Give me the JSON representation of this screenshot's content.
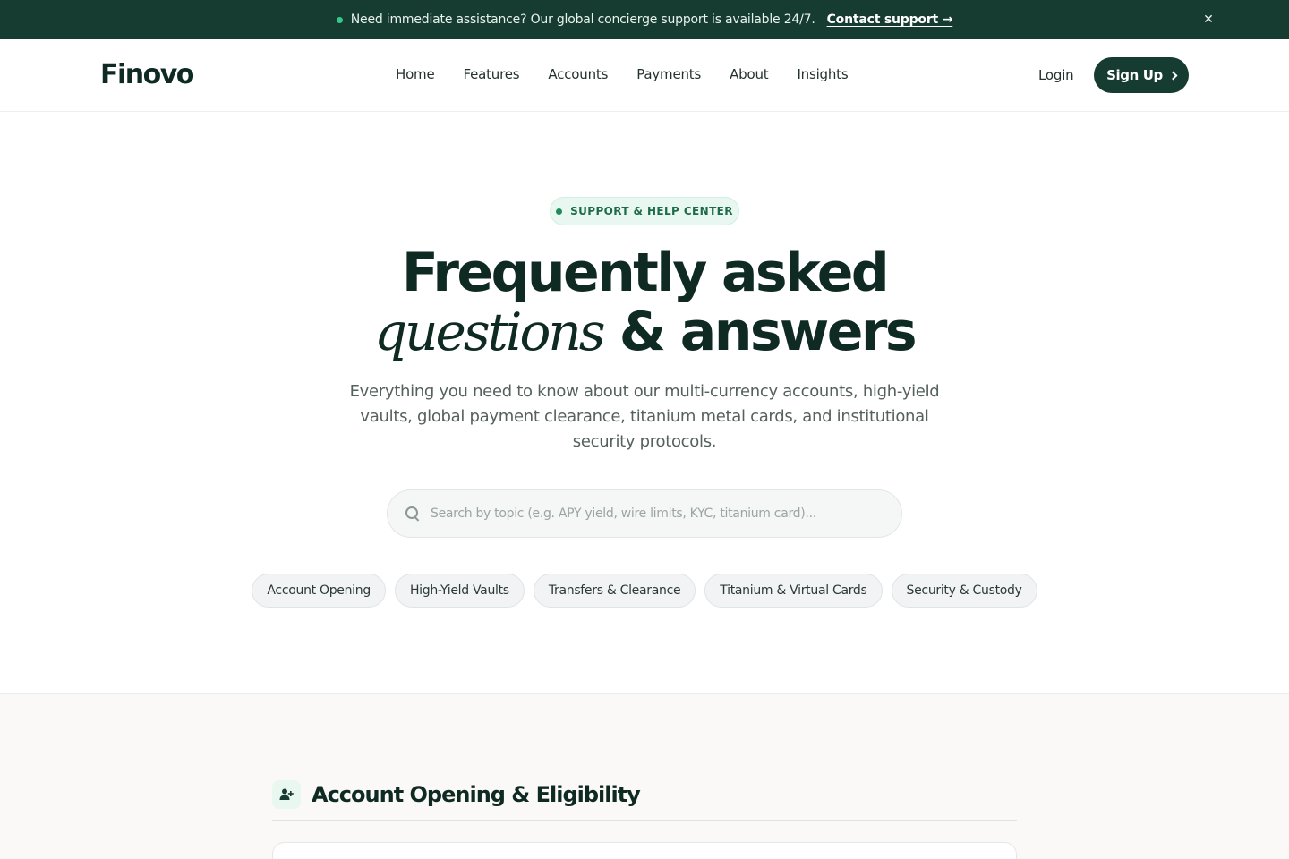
{
  "announcement": {
    "message": "Need immediate assistance? Our global concierge support is available 24/7.",
    "link_label": "Contact support →",
    "close_label": "✕"
  },
  "header": {
    "logo": "Finovo",
    "nav": [
      "Home",
      "Features",
      "Accounts",
      "Payments",
      "About",
      "Insights"
    ],
    "login_label": "Login",
    "signup_label": "Sign Up"
  },
  "hero": {
    "badge": "SUPPORT & HELP CENTER",
    "title_line1": "Frequently asked",
    "title_italic": "questions",
    "title_rest": "& answers",
    "subtitle": "Everything you need to know about our multi-currency accounts, high-yield vaults, global payment clearance, titanium metal cards, and institutional security protocols.",
    "search_placeholder": "Search by topic (e.g. APY yield, wire limits, KYC, titanium card)...",
    "chips": [
      "Account Opening",
      "High-Yield Vaults",
      "Transfers & Clearance",
      "Titanium & Virtual Cards",
      "Security & Custody"
    ]
  },
  "section": {
    "title": "Account Opening & Eligibility",
    "icon": "user-plus-icon"
  },
  "colors": {
    "brand_dark": "#163b30",
    "accent_green": "#34c98a",
    "badge_bg": "#e8f7ef"
  }
}
